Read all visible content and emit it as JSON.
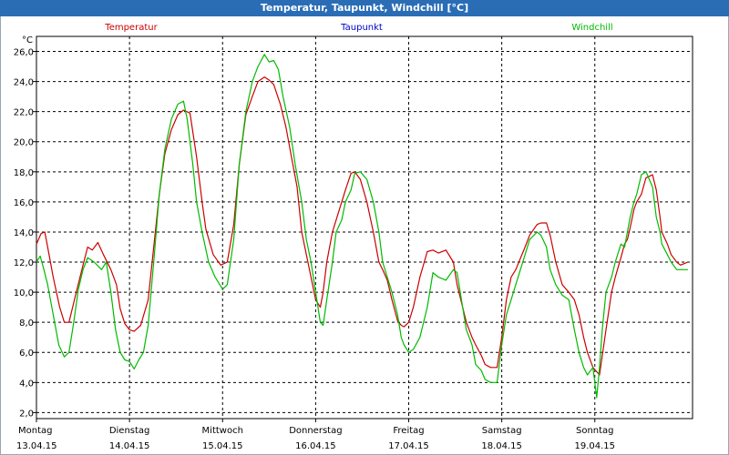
{
  "window": {
    "title": "Temperatur, Taupunkt, Windchill [°C]"
  },
  "chart_data": {
    "type": "line",
    "title": "Temperatur, Taupunkt, Windchill [°C]",
    "ylabel": "°C",
    "ylim": [
      1.6,
      27.0
    ],
    "xlim": [
      0,
      7.05
    ],
    "yticks": [
      "26,0",
      "24,0",
      "22,0",
      "20,0",
      "18,0",
      "16,0",
      "14,0",
      "12,0",
      "10,0",
      "8,0",
      "6,0",
      "4,0",
      "2,0"
    ],
    "ytick_values": [
      26,
      24,
      22,
      20,
      18,
      16,
      14,
      12,
      10,
      8,
      6,
      4,
      2
    ],
    "xticks": [
      {
        "day": "Montag",
        "date": "13.04.15"
      },
      {
        "day": "Dienstag",
        "date": "14.04.15"
      },
      {
        "day": "Mittwoch",
        "date": "15.04.15"
      },
      {
        "day": "Donnerstag",
        "date": "16.04.15"
      },
      {
        "day": "Freitag",
        "date": "17.04.15"
      },
      {
        "day": "Samstag",
        "date": "18.04.15"
      },
      {
        "day": "Sonntag",
        "date": "19.04.15"
      }
    ],
    "grid": true,
    "legend": [
      "Temperatur",
      "Taupunkt",
      "Windchill"
    ],
    "series": [
      {
        "name": "Temperatur",
        "color": "#cc0000",
        "x": [
          0.0,
          0.05,
          0.09,
          0.12,
          0.18,
          0.25,
          0.3,
          0.35,
          0.42,
          0.5,
          0.55,
          0.6,
          0.66,
          0.72,
          0.8,
          0.86,
          0.9,
          0.95,
          1.0,
          1.05,
          1.12,
          1.2,
          1.26,
          1.32,
          1.38,
          1.45,
          1.52,
          1.58,
          1.65,
          1.72,
          1.78,
          1.82,
          1.9,
          1.98,
          2.05,
          2.12,
          2.18,
          2.25,
          2.32,
          2.38,
          2.45,
          2.5,
          2.55,
          2.62,
          2.68,
          2.74,
          2.8,
          2.85,
          2.9,
          2.95,
          3.0,
          3.05,
          3.08,
          3.12,
          3.18,
          3.22,
          3.28,
          3.32,
          3.38,
          3.42,
          3.48,
          3.55,
          3.62,
          3.68,
          3.72,
          3.77,
          3.82,
          3.88,
          3.92,
          3.95,
          4.0,
          4.05,
          4.12,
          4.2,
          4.26,
          4.32,
          4.4,
          4.48,
          4.52,
          4.58,
          4.62,
          4.68,
          4.72,
          4.78,
          4.82,
          4.88,
          4.95,
          5.0,
          5.05,
          5.1,
          5.15,
          5.25,
          5.3,
          5.38,
          5.42,
          5.48,
          5.52,
          5.58,
          5.65,
          5.72,
          5.78,
          5.83,
          5.88,
          5.92,
          5.98,
          6.05,
          6.12,
          6.18,
          6.22,
          6.28,
          6.32,
          6.35,
          6.38,
          6.42,
          6.45,
          6.5,
          6.55,
          6.62,
          6.66,
          6.7,
          6.72,
          6.78,
          6.82,
          6.88,
          6.92,
          6.96,
          7.0
        ],
        "values": [
          13.2,
          13.9,
          14.0,
          13.0,
          11.0,
          9.0,
          8.0,
          8.0,
          9.8,
          11.8,
          13.0,
          12.8,
          13.3,
          12.5,
          11.5,
          10.5,
          8.9,
          7.9,
          7.5,
          7.4,
          7.8,
          9.5,
          13.0,
          16.5,
          19.2,
          20.8,
          21.8,
          22.1,
          21.9,
          19.0,
          16.0,
          14.2,
          12.5,
          11.8,
          12.0,
          14.5,
          18.5,
          21.8,
          23.0,
          24.0,
          24.3,
          24.1,
          23.8,
          22.5,
          21.0,
          19.0,
          17.0,
          14.0,
          12.5,
          11.0,
          9.5,
          9.0,
          10.0,
          12.0,
          14.0,
          14.8,
          16.0,
          16.8,
          17.9,
          18.0,
          17.5,
          16.0,
          14.0,
          12.0,
          11.5,
          10.8,
          9.5,
          8.1,
          7.8,
          7.7,
          8.0,
          9.0,
          11.0,
          12.7,
          12.8,
          12.6,
          12.8,
          12.0,
          10.5,
          9.0,
          8.0,
          7.0,
          6.5,
          5.8,
          5.2,
          5.0,
          5.0,
          7.0,
          9.5,
          11.0,
          11.5,
          13.0,
          13.8,
          14.5,
          14.6,
          14.6,
          13.8,
          12.0,
          10.5,
          10.0,
          9.5,
          8.5,
          7.0,
          6.0,
          5.0,
          4.5,
          7.5,
          10.0,
          11.0,
          12.3,
          13.2,
          13.5,
          14.3,
          15.5,
          16.0,
          16.5,
          17.6,
          17.8,
          16.8,
          15.0,
          14.0,
          13.2,
          12.5,
          12.0,
          11.8,
          11.9,
          12.0
        ]
      },
      {
        "name": "Windchill",
        "color": "#00bb00",
        "x": [
          0.0,
          0.04,
          0.08,
          0.12,
          0.18,
          0.24,
          0.3,
          0.35,
          0.4,
          0.45,
          0.5,
          0.55,
          0.62,
          0.7,
          0.75,
          0.8,
          0.85,
          0.9,
          0.95,
          1.0,
          1.05,
          1.1,
          1.15,
          1.2,
          1.26,
          1.32,
          1.38,
          1.45,
          1.52,
          1.58,
          1.62,
          1.68,
          1.72,
          1.78,
          1.85,
          1.92,
          2.0,
          2.05,
          2.12,
          2.18,
          2.25,
          2.32,
          2.38,
          2.45,
          2.5,
          2.55,
          2.6,
          2.65,
          2.72,
          2.78,
          2.85,
          2.9,
          2.95,
          3.0,
          3.05,
          3.08,
          3.12,
          3.18,
          3.22,
          3.28,
          3.32,
          3.38,
          3.42,
          3.48,
          3.55,
          3.62,
          3.68,
          3.72,
          3.77,
          3.82,
          3.88,
          3.92,
          3.95,
          4.0,
          4.05,
          4.12,
          4.2,
          4.26,
          4.32,
          4.4,
          4.48,
          4.52,
          4.58,
          4.62,
          4.68,
          4.72,
          4.78,
          4.82,
          4.88,
          4.95,
          5.0,
          5.05,
          5.1,
          5.15,
          5.25,
          5.3,
          5.38,
          5.42,
          5.48,
          5.52,
          5.58,
          5.65,
          5.72,
          5.78,
          5.83,
          5.88,
          5.92,
          5.98,
          6.02,
          6.05,
          6.08,
          6.12,
          6.18,
          6.22,
          6.28,
          6.32,
          6.35,
          6.38,
          6.42,
          6.45,
          6.5,
          6.55,
          6.62,
          6.66,
          6.7,
          6.72,
          6.78,
          6.82,
          6.88,
          6.92,
          6.96,
          7.0
        ],
        "values": [
          12.0,
          12.4,
          11.5,
          10.5,
          8.5,
          6.5,
          5.7,
          6.0,
          8.0,
          10.2,
          11.5,
          12.3,
          12.0,
          11.5,
          12.0,
          10.0,
          7.5,
          6.0,
          5.5,
          5.4,
          4.9,
          5.5,
          6.0,
          7.8,
          12.0,
          16.5,
          19.5,
          21.5,
          22.5,
          22.7,
          21.5,
          18.5,
          16.0,
          14.0,
          12.0,
          11.0,
          10.2,
          10.5,
          13.5,
          18.5,
          22.0,
          24.0,
          25.0,
          25.8,
          25.3,
          25.4,
          24.8,
          23.0,
          21.0,
          18.5,
          16.0,
          13.5,
          12.0,
          10.0,
          8.0,
          7.8,
          9.5,
          12.0,
          14.0,
          14.8,
          16.0,
          16.8,
          17.9,
          18.0,
          17.5,
          16.0,
          14.0,
          12.0,
          11.0,
          10.0,
          8.5,
          7.0,
          6.5,
          6.0,
          6.2,
          7.0,
          9.0,
          11.3,
          11.0,
          10.8,
          11.5,
          11.3,
          9.0,
          7.5,
          6.5,
          5.2,
          4.8,
          4.2,
          4.0,
          4.0,
          6.5,
          8.5,
          9.5,
          10.5,
          12.5,
          13.5,
          14.0,
          13.8,
          13.0,
          11.5,
          10.5,
          9.8,
          9.5,
          7.5,
          6.0,
          5.0,
          4.5,
          5.0,
          3.0,
          5.0,
          7.5,
          10.0,
          11.0,
          12.0,
          13.2,
          13.0,
          14.0,
          15.0,
          16.0,
          16.5,
          17.8,
          18.0,
          17.0,
          15.0,
          14.0,
          13.2,
          12.5,
          12.0,
          11.5,
          11.5,
          11.5,
          11.5
        ]
      }
    ]
  }
}
